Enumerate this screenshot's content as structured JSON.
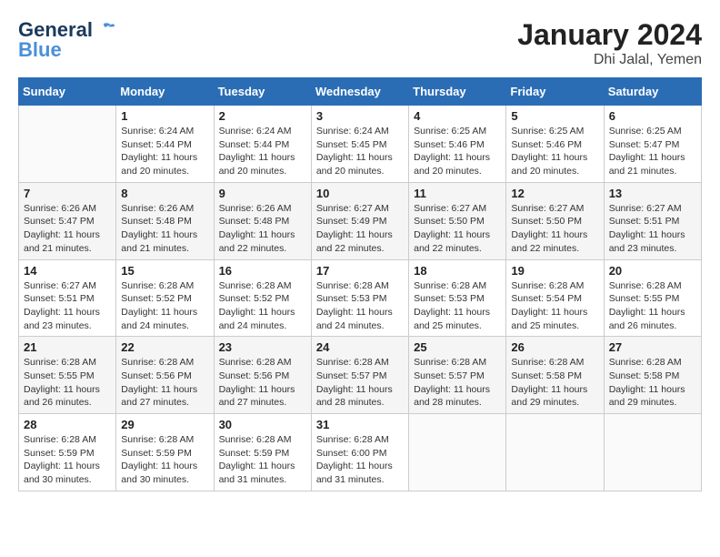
{
  "logo": {
    "line1": "General",
    "line2": "Blue"
  },
  "title": "January 2024",
  "subtitle": "Dhi Jalal, Yemen",
  "days_of_week": [
    "Sunday",
    "Monday",
    "Tuesday",
    "Wednesday",
    "Thursday",
    "Friday",
    "Saturday"
  ],
  "weeks": [
    [
      {
        "day": "",
        "sunrise": "",
        "sunset": "",
        "daylight": ""
      },
      {
        "day": "1",
        "sunrise": "Sunrise: 6:24 AM",
        "sunset": "Sunset: 5:44 PM",
        "daylight": "Daylight: 11 hours and 20 minutes."
      },
      {
        "day": "2",
        "sunrise": "Sunrise: 6:24 AM",
        "sunset": "Sunset: 5:44 PM",
        "daylight": "Daylight: 11 hours and 20 minutes."
      },
      {
        "day": "3",
        "sunrise": "Sunrise: 6:24 AM",
        "sunset": "Sunset: 5:45 PM",
        "daylight": "Daylight: 11 hours and 20 minutes."
      },
      {
        "day": "4",
        "sunrise": "Sunrise: 6:25 AM",
        "sunset": "Sunset: 5:46 PM",
        "daylight": "Daylight: 11 hours and 20 minutes."
      },
      {
        "day": "5",
        "sunrise": "Sunrise: 6:25 AM",
        "sunset": "Sunset: 5:46 PM",
        "daylight": "Daylight: 11 hours and 20 minutes."
      },
      {
        "day": "6",
        "sunrise": "Sunrise: 6:25 AM",
        "sunset": "Sunset: 5:47 PM",
        "daylight": "Daylight: 11 hours and 21 minutes."
      }
    ],
    [
      {
        "day": "7",
        "sunrise": "Sunrise: 6:26 AM",
        "sunset": "Sunset: 5:47 PM",
        "daylight": "Daylight: 11 hours and 21 minutes."
      },
      {
        "day": "8",
        "sunrise": "Sunrise: 6:26 AM",
        "sunset": "Sunset: 5:48 PM",
        "daylight": "Daylight: 11 hours and 21 minutes."
      },
      {
        "day": "9",
        "sunrise": "Sunrise: 6:26 AM",
        "sunset": "Sunset: 5:48 PM",
        "daylight": "Daylight: 11 hours and 22 minutes."
      },
      {
        "day": "10",
        "sunrise": "Sunrise: 6:27 AM",
        "sunset": "Sunset: 5:49 PM",
        "daylight": "Daylight: 11 hours and 22 minutes."
      },
      {
        "day": "11",
        "sunrise": "Sunrise: 6:27 AM",
        "sunset": "Sunset: 5:50 PM",
        "daylight": "Daylight: 11 hours and 22 minutes."
      },
      {
        "day": "12",
        "sunrise": "Sunrise: 6:27 AM",
        "sunset": "Sunset: 5:50 PM",
        "daylight": "Daylight: 11 hours and 22 minutes."
      },
      {
        "day": "13",
        "sunrise": "Sunrise: 6:27 AM",
        "sunset": "Sunset: 5:51 PM",
        "daylight": "Daylight: 11 hours and 23 minutes."
      }
    ],
    [
      {
        "day": "14",
        "sunrise": "Sunrise: 6:27 AM",
        "sunset": "Sunset: 5:51 PM",
        "daylight": "Daylight: 11 hours and 23 minutes."
      },
      {
        "day": "15",
        "sunrise": "Sunrise: 6:28 AM",
        "sunset": "Sunset: 5:52 PM",
        "daylight": "Daylight: 11 hours and 24 minutes."
      },
      {
        "day": "16",
        "sunrise": "Sunrise: 6:28 AM",
        "sunset": "Sunset: 5:52 PM",
        "daylight": "Daylight: 11 hours and 24 minutes."
      },
      {
        "day": "17",
        "sunrise": "Sunrise: 6:28 AM",
        "sunset": "Sunset: 5:53 PM",
        "daylight": "Daylight: 11 hours and 24 minutes."
      },
      {
        "day": "18",
        "sunrise": "Sunrise: 6:28 AM",
        "sunset": "Sunset: 5:53 PM",
        "daylight": "Daylight: 11 hours and 25 minutes."
      },
      {
        "day": "19",
        "sunrise": "Sunrise: 6:28 AM",
        "sunset": "Sunset: 5:54 PM",
        "daylight": "Daylight: 11 hours and 25 minutes."
      },
      {
        "day": "20",
        "sunrise": "Sunrise: 6:28 AM",
        "sunset": "Sunset: 5:55 PM",
        "daylight": "Daylight: 11 hours and 26 minutes."
      }
    ],
    [
      {
        "day": "21",
        "sunrise": "Sunrise: 6:28 AM",
        "sunset": "Sunset: 5:55 PM",
        "daylight": "Daylight: 11 hours and 26 minutes."
      },
      {
        "day": "22",
        "sunrise": "Sunrise: 6:28 AM",
        "sunset": "Sunset: 5:56 PM",
        "daylight": "Daylight: 11 hours and 27 minutes."
      },
      {
        "day": "23",
        "sunrise": "Sunrise: 6:28 AM",
        "sunset": "Sunset: 5:56 PM",
        "daylight": "Daylight: 11 hours and 27 minutes."
      },
      {
        "day": "24",
        "sunrise": "Sunrise: 6:28 AM",
        "sunset": "Sunset: 5:57 PM",
        "daylight": "Daylight: 11 hours and 28 minutes."
      },
      {
        "day": "25",
        "sunrise": "Sunrise: 6:28 AM",
        "sunset": "Sunset: 5:57 PM",
        "daylight": "Daylight: 11 hours and 28 minutes."
      },
      {
        "day": "26",
        "sunrise": "Sunrise: 6:28 AM",
        "sunset": "Sunset: 5:58 PM",
        "daylight": "Daylight: 11 hours and 29 minutes."
      },
      {
        "day": "27",
        "sunrise": "Sunrise: 6:28 AM",
        "sunset": "Sunset: 5:58 PM",
        "daylight": "Daylight: 11 hours and 29 minutes."
      }
    ],
    [
      {
        "day": "28",
        "sunrise": "Sunrise: 6:28 AM",
        "sunset": "Sunset: 5:59 PM",
        "daylight": "Daylight: 11 hours and 30 minutes."
      },
      {
        "day": "29",
        "sunrise": "Sunrise: 6:28 AM",
        "sunset": "Sunset: 5:59 PM",
        "daylight": "Daylight: 11 hours and 30 minutes."
      },
      {
        "day": "30",
        "sunrise": "Sunrise: 6:28 AM",
        "sunset": "Sunset: 5:59 PM",
        "daylight": "Daylight: 11 hours and 31 minutes."
      },
      {
        "day": "31",
        "sunrise": "Sunrise: 6:28 AM",
        "sunset": "Sunset: 6:00 PM",
        "daylight": "Daylight: 11 hours and 31 minutes."
      },
      {
        "day": "",
        "sunrise": "",
        "sunset": "",
        "daylight": ""
      },
      {
        "day": "",
        "sunrise": "",
        "sunset": "",
        "daylight": ""
      },
      {
        "day": "",
        "sunrise": "",
        "sunset": "",
        "daylight": ""
      }
    ]
  ]
}
